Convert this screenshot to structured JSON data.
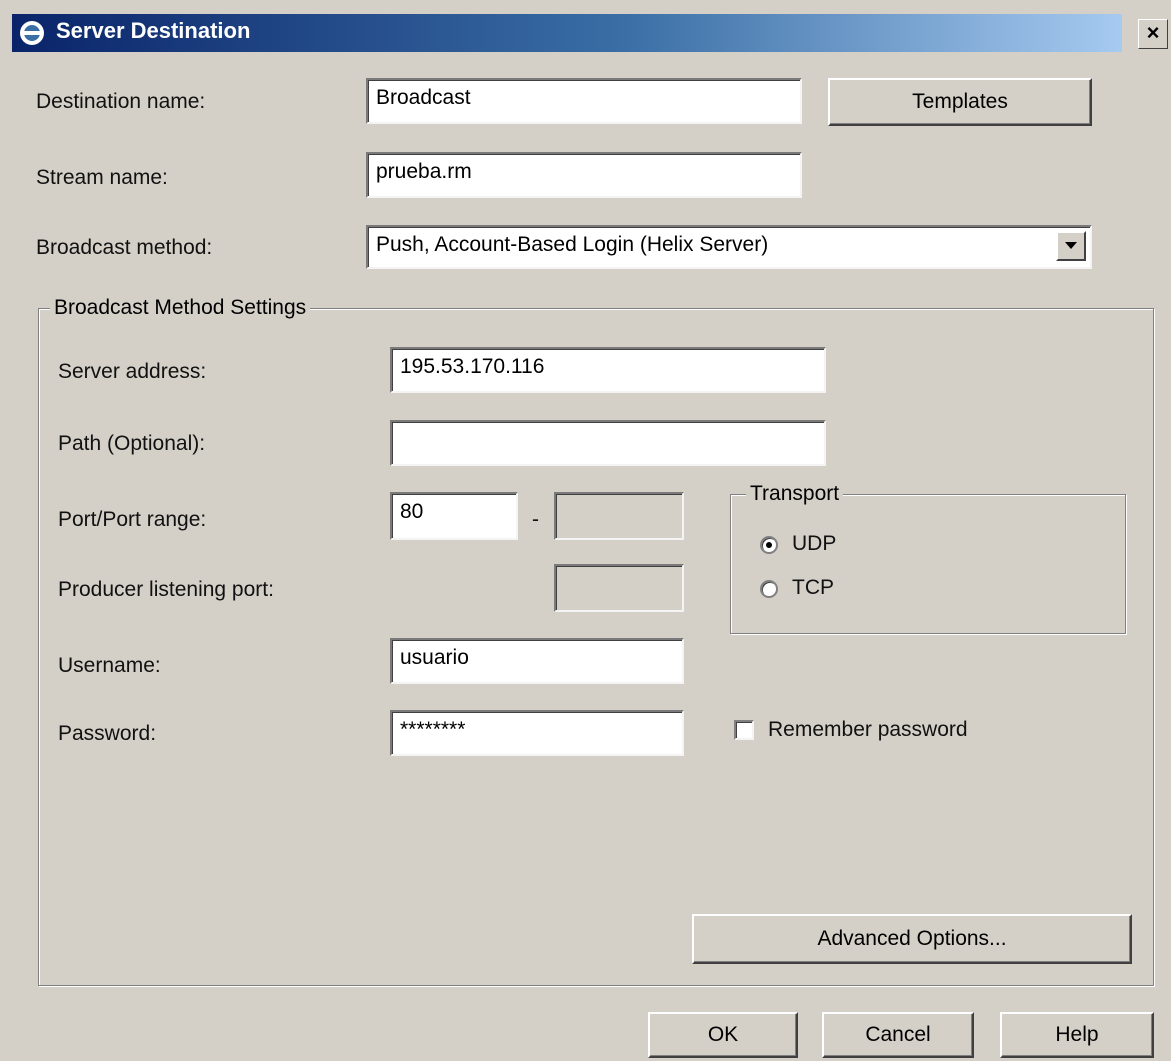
{
  "window": {
    "title": "Server Destination",
    "close_glyph": "×",
    "app_icon": "realproducer-icon"
  },
  "form": {
    "destination_name": {
      "label": "Destination name:",
      "value": "Broadcast"
    },
    "templates_button": "Templates",
    "stream_name": {
      "label": "Stream name:",
      "value": "prueba.rm"
    },
    "broadcast_method": {
      "label": "Broadcast method:",
      "value": "Push, Account-Based Login (Helix Server)"
    }
  },
  "settings": {
    "group_title": "Broadcast Method Settings",
    "server_address": {
      "label": "Server address:",
      "value": "195.53.170.116"
    },
    "path": {
      "label": "Path (Optional):",
      "value": ""
    },
    "port_range": {
      "label": "Port/Port range:",
      "from": "80",
      "separator": "-",
      "to": ""
    },
    "producer_port": {
      "label": "Producer listening port:",
      "value": ""
    },
    "username": {
      "label": "Username:",
      "value": "usuario"
    },
    "password": {
      "label": "Password:",
      "value": "********"
    },
    "remember_password": {
      "label": "Remember password",
      "checked": false
    },
    "transport": {
      "title": "Transport",
      "options": [
        {
          "label": "UDP",
          "checked": true
        },
        {
          "label": "TCP",
          "checked": false
        }
      ]
    },
    "advanced_button": "Advanced Options..."
  },
  "footer": {
    "ok": "OK",
    "cancel": "Cancel",
    "help": "Help"
  },
  "colors": {
    "dialog_bg": "#d4d0c8",
    "title_start": "#0a246a",
    "title_end": "#a6caf0"
  }
}
